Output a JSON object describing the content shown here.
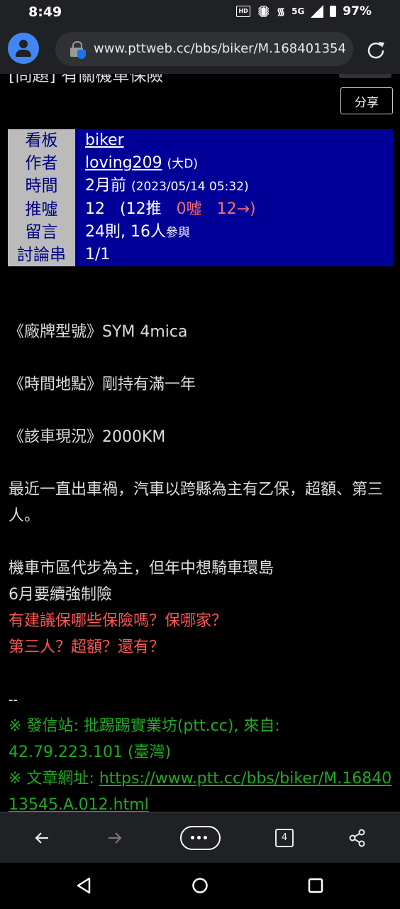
{
  "status": {
    "time": "8:49",
    "battery": "97%",
    "network": "5G"
  },
  "browser": {
    "url": "www.pttweb.cc/bbs/biker/M.168401354"
  },
  "post": {
    "title_partial": "[問題] 有關機車保險",
    "share_label": "分享",
    "meta": [
      {
        "key": "看板",
        "value": "biker"
      },
      {
        "key": "作者",
        "value": "loving209",
        "sub": "(大D)"
      },
      {
        "key": "時間",
        "value": "2月前",
        "sub": "(2023/05/14 05:32)"
      },
      {
        "key": "推噓",
        "score": "12",
        "push": "(12推",
        "boo": "0噓",
        "arrow": "12→)"
      },
      {
        "key": "留言",
        "value": "24則, 16人",
        "sub": "參與"
      },
      {
        "key": "討論串",
        "value": "1/1"
      }
    ],
    "lines": [
      "《廠牌型號》SYM 4mica",
      "《時間地點》剛持有滿一年",
      "《該車現況》2000KM",
      "最近一直出車禍，汽車以跨縣為主有乙保，超額、第三人。",
      "機車市區代步為主，但年中想騎車環島",
      "6月要續強制險"
    ],
    "red_lines": [
      "有建議保哪些保險嗎？保哪家？",
      "第三人？超額？還有？"
    ],
    "signature": "--",
    "footer_station": "※ 發信站: 批踢踢實業坊(ptt.cc), 來自: 42.79.223.101 (臺灣)",
    "footer_url_label": "※ 文章網址: ",
    "footer_url": "https://www.ptt.cc/bbs/biker/M.1684013545.A.012.html"
  },
  "navbar": {
    "tab_count": "4"
  }
}
